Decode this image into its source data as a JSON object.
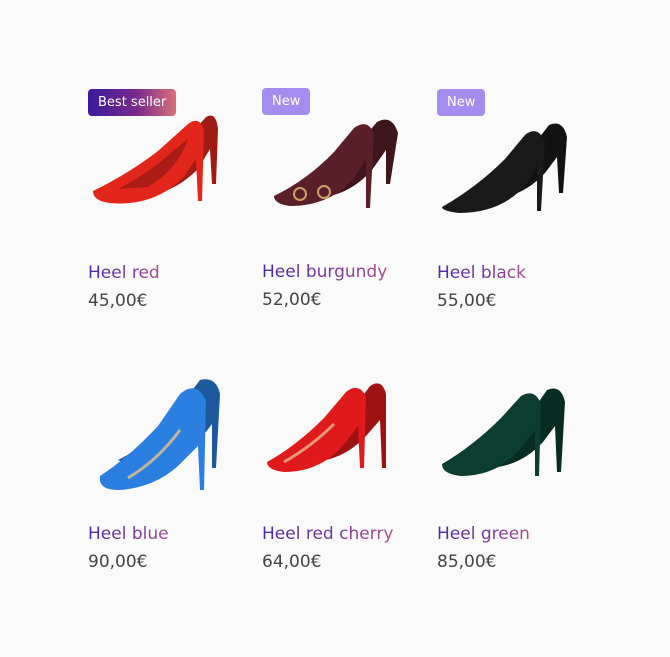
{
  "products": [
    {
      "name": "Heel red",
      "price": "45,00€",
      "badge": "Best seller",
      "color": "#e3261b"
    },
    {
      "name": "Heel burgundy",
      "price": "52,00€",
      "badge": "New",
      "color": "#5a1f28"
    },
    {
      "name": "Heel black",
      "price": "55,00€",
      "badge": "New",
      "color": "#1a1a1a"
    },
    {
      "name": "Heel blue",
      "price": "90,00€",
      "badge": "",
      "color": "#2a7fe0"
    },
    {
      "name": "Heel red cherry",
      "price": "64,00€",
      "badge": "",
      "color": "#e01a1a"
    },
    {
      "name": "Heel green",
      "price": "85,00€",
      "badge": "",
      "color": "#0c3d30"
    }
  ]
}
